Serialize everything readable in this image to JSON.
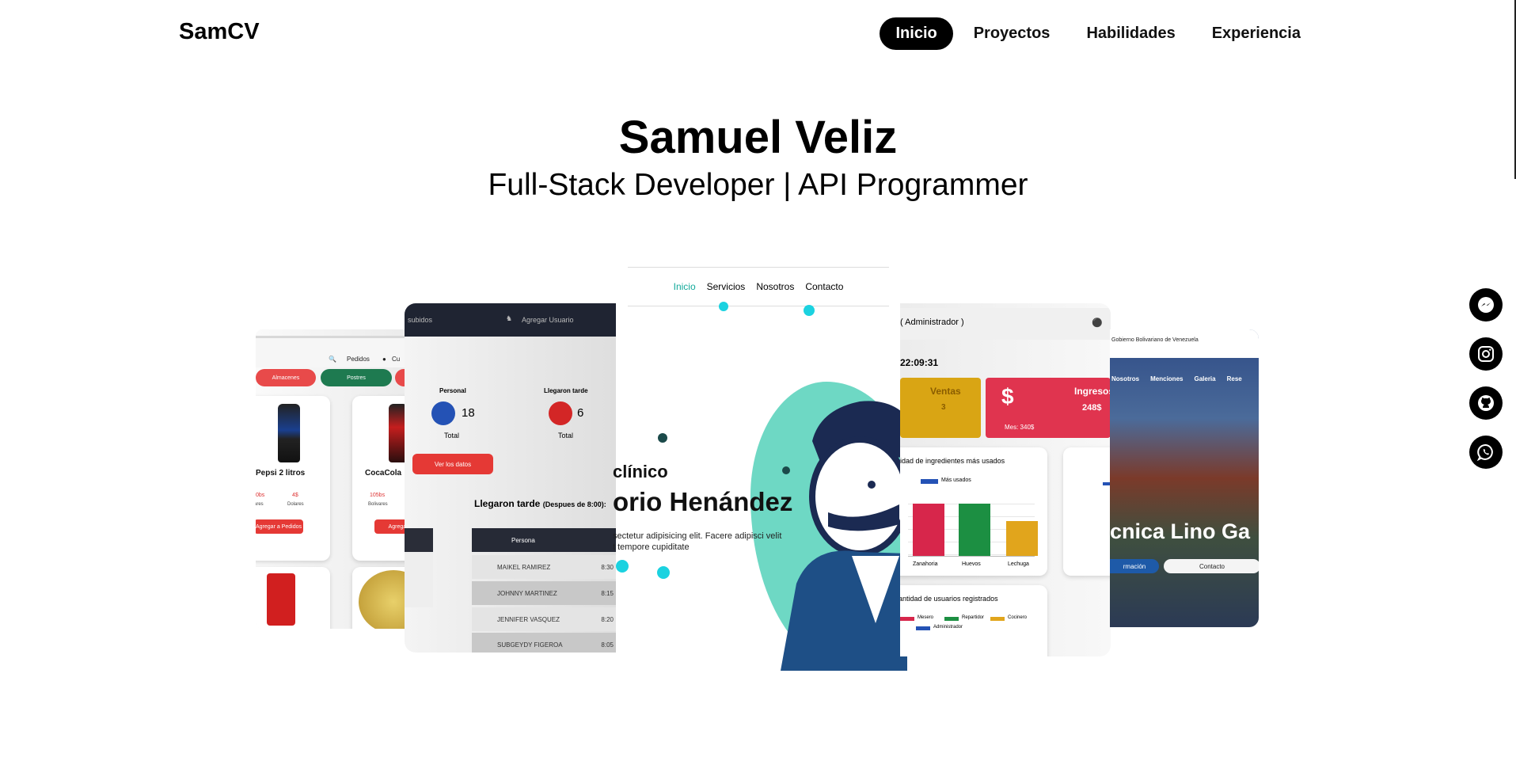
{
  "navbar": {
    "brand": "SamCV",
    "items": [
      {
        "label": "Inicio",
        "active": true
      },
      {
        "label": "Proyectos",
        "active": false
      },
      {
        "label": "Habilidades",
        "active": false
      },
      {
        "label": "Experiencia",
        "active": false
      }
    ]
  },
  "hero": {
    "name": "Samuel Veliz",
    "subtitle": "Full-Stack Developer | API Programmer"
  },
  "social": [
    {
      "icon": "messenger-icon"
    },
    {
      "icon": "instagram-icon"
    },
    {
      "icon": "github-icon"
    },
    {
      "icon": "whatsapp-icon"
    }
  ],
  "projects": {
    "store": {
      "menu": [
        "Pedidos",
        "Cu"
      ],
      "tabs": [
        "Almacenes",
        "Postres"
      ],
      "products": [
        {
          "name": "Pepsi 2 litros",
          "price_bs": "0bs",
          "price_usd": "4$",
          "label_bs": "ares",
          "label_usd": "Dolares"
        },
        {
          "name": "CocaCola",
          "price_bs": "105bs",
          "label_bs": "Bolivares"
        }
      ],
      "add_button": "Agregar a Pedidos",
      "add_button_2": "Agregar"
    },
    "attendance": {
      "topbar": [
        "subidos",
        "Agregar Usuario"
      ],
      "stats": [
        {
          "label": "Personal",
          "value": "18",
          "caption": "Total"
        },
        {
          "label": "Llegaron tarde",
          "value": "6",
          "caption": "Total"
        }
      ],
      "button": "Ver los datos",
      "section_title": "Llegaron tarde",
      "section_note": "(Despues de 8:00):",
      "table_header": "Persona",
      "rows": [
        {
          "name": "MAIKEL RAMIREZ",
          "time": "8:30"
        },
        {
          "name": "JOHNNY MARTINEZ",
          "time": "8:15"
        },
        {
          "name": "JENNIFER VASQUEZ",
          "time": "8:20"
        },
        {
          "name": "SUBGEYDY FIGEROA",
          "time": "8:05"
        }
      ]
    },
    "clinic": {
      "nav": [
        "Inicio",
        "Servicios",
        "Nosotros",
        "Contacto"
      ],
      "heading1": "clínico",
      "heading2": "orio Henández",
      "text1": "sectetur adipisicing elit. Facere adipisci velit",
      "text2": "t tempore cupiditate"
    },
    "dashboard": {
      "role": "( Administrador )",
      "clock": "22:09:31",
      "tiles": [
        {
          "title": "Ventas",
          "value": "3",
          "color": "#d9a514"
        },
        {
          "title": "Ingresos",
          "value": "248$",
          "color": "#e0344f",
          "note": "Mes: 340$"
        }
      ],
      "chart_title": "idad de ingredientes más usados",
      "chart_legend": "Más usados",
      "chart_labels": [
        "Zanahoria",
        "Huevos",
        "Lechuga"
      ],
      "chart2_title": "antidad de usuarios registrados",
      "chart2_legend": [
        "Mesero",
        "Repartidor",
        "Cocinero",
        "Administrador"
      ]
    },
    "school": {
      "gov": "Gobierno Bolivariano de Venezuela",
      "nav": [
        "Nosotros",
        "Menciones",
        "Galeria",
        "Rese"
      ],
      "heading": "cnica Lino Ga",
      "buttons": [
        "rmación",
        "Contacto"
      ]
    }
  }
}
